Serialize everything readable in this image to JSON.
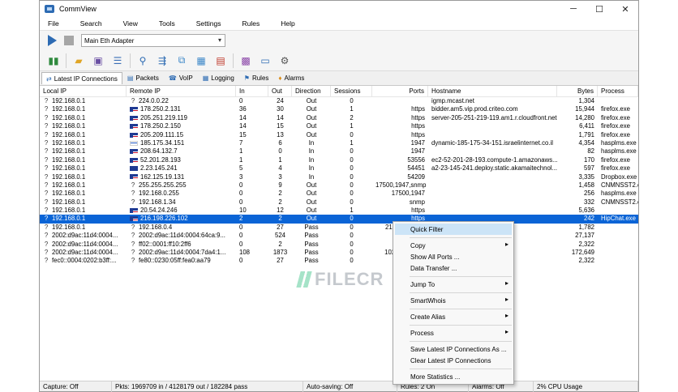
{
  "window": {
    "title": "CommView",
    "minimize": "─",
    "maximize": "☐",
    "close": "✕"
  },
  "menu": [
    "File",
    "Search",
    "View",
    "Tools",
    "Settings",
    "Rules",
    "Help"
  ],
  "adapter": {
    "value": "Main Eth Adapter"
  },
  "tabs": [
    {
      "label": "Latest IP Connections",
      "icon": "connections-icon"
    },
    {
      "label": "Packets",
      "icon": "packets-icon"
    },
    {
      "label": "VoIP",
      "icon": "voip-icon"
    },
    {
      "label": "Logging",
      "icon": "logging-icon"
    },
    {
      "label": "Rules",
      "icon": "rules-icon"
    },
    {
      "label": "Alarms",
      "icon": "alarms-icon"
    }
  ],
  "columns": [
    "Local IP",
    "Remote IP",
    "In",
    "Out",
    "Direction",
    "Sessions",
    "Ports",
    "Hostname",
    "Bytes",
    "Process"
  ],
  "rows": [
    {
      "local": "192.168.0.1",
      "flag": "none",
      "remote": "224.0.0.22",
      "in": "0",
      "out": "24",
      "dir": "Out",
      "sess": "0",
      "ports": "",
      "host": "igmp.mcast.net",
      "bytes": "1,304",
      "proc": ""
    },
    {
      "local": "192.168.0.1",
      "flag": "us",
      "remote": "178.250.2.131",
      "in": "36",
      "out": "30",
      "dir": "Out",
      "sess": "1",
      "ports": "https",
      "host": "bidder.am5.vip.prod.criteo.com",
      "bytes": "15,944",
      "proc": "firefox.exe"
    },
    {
      "local": "192.168.0.1",
      "flag": "us",
      "remote": "205.251.219.119",
      "in": "14",
      "out": "14",
      "dir": "Out",
      "sess": "2",
      "ports": "https",
      "host": "server-205-251-219-119.am1.r.cloudfront.net",
      "bytes": "14,280",
      "proc": "firefox.exe"
    },
    {
      "local": "192.168.0.1",
      "flag": "us",
      "remote": "178.250.2.150",
      "in": "14",
      "out": "15",
      "dir": "Out",
      "sess": "1",
      "ports": "https",
      "host": "",
      "bytes": "6,411",
      "proc": "firefox.exe"
    },
    {
      "local": "192.168.0.1",
      "flag": "us",
      "remote": "205.209.111.15",
      "in": "15",
      "out": "13",
      "dir": "Out",
      "sess": "0",
      "ports": "https",
      "host": "",
      "bytes": "1,791",
      "proc": "firefox.exe"
    },
    {
      "local": "192.168.0.1",
      "flag": "il",
      "remote": "185.175.34.151",
      "in": "7",
      "out": "6",
      "dir": "In",
      "sess": "1",
      "ports": "1947",
      "host": "dynamic-185-175-34-151.israelinternet.co.il",
      "bytes": "4,354",
      "proc": "hasplms.exe"
    },
    {
      "local": "192.168.0.1",
      "flag": "us",
      "remote": "208.64.132.7",
      "in": "1",
      "out": "0",
      "dir": "In",
      "sess": "0",
      "ports": "1947",
      "host": "",
      "bytes": "82",
      "proc": "hasplms.exe"
    },
    {
      "local": "192.168.0.1",
      "flag": "us",
      "remote": "52.201.28.193",
      "in": "1",
      "out": "1",
      "dir": "In",
      "sess": "0",
      "ports": "53556",
      "host": "ec2-52-201-28-193.compute-1.amazonaws...",
      "bytes": "170",
      "proc": "firefox.exe"
    },
    {
      "local": "192.168.0.1",
      "flag": "eu",
      "remote": "2.23.145.241",
      "in": "5",
      "out": "4",
      "dir": "In",
      "sess": "0",
      "ports": "54451",
      "host": "a2-23-145-241.deploy.static.akamaitechnol...",
      "bytes": "597",
      "proc": "firefox.exe"
    },
    {
      "local": "192.168.0.1",
      "flag": "us",
      "remote": "162.125.19.131",
      "in": "3",
      "out": "3",
      "dir": "In",
      "sess": "0",
      "ports": "54209",
      "host": "",
      "bytes": "3,335",
      "proc": "Dropbox.exe"
    },
    {
      "local": "192.168.0.1",
      "flag": "none",
      "remote": "255.255.255.255",
      "in": "0",
      "out": "9",
      "dir": "Out",
      "sess": "0",
      "ports": "17500,1947,snmp",
      "host": "",
      "bytes": "1,458",
      "proc": "CNMNSST2.exe"
    },
    {
      "local": "192.168.0.1",
      "flag": "none",
      "remote": "192.168.0.255",
      "in": "0",
      "out": "2",
      "dir": "Out",
      "sess": "0",
      "ports": "17500,1947",
      "host": "",
      "bytes": "256",
      "proc": "hasplms.exe"
    },
    {
      "local": "192.168.0.1",
      "flag": "none",
      "remote": "192.168.1.34",
      "in": "0",
      "out": "2",
      "dir": "Out",
      "sess": "0",
      "ports": "snmp",
      "host": "",
      "bytes": "332",
      "proc": "CNMNSST2.exe"
    },
    {
      "local": "192.168.0.1",
      "flag": "us",
      "remote": "20.54.24.246",
      "in": "10",
      "out": "12",
      "dir": "Out",
      "sess": "1",
      "ports": "https",
      "host": "",
      "bytes": "5,636",
      "proc": ""
    },
    {
      "local": "192.168.0.1",
      "flag": "us",
      "remote": "216.198.226.102",
      "in": "2",
      "out": "2",
      "dir": "Out",
      "sess": "0",
      "ports": "https",
      "host": "",
      "bytes": "242",
      "proc": "HipChat.exe",
      "selected": true
    },
    {
      "local": "192.168.0.1",
      "flag": "none",
      "remote": "192.168.0.4",
      "in": "0",
      "out": "27",
      "dir": "Pass",
      "sess": "0",
      "ports": "2140,micros...",
      "host": "",
      "bytes": "1,782",
      "proc": ""
    },
    {
      "local": "2002:d9ac:11d4:0004...",
      "flag": "none",
      "remote": "2002:d9ac:11d4:0004:64ca:9...",
      "in": "0",
      "out": "524",
      "dir": "Pass",
      "sess": "0",
      "ports": "7078,51...",
      "host": "",
      "bytes": "27,137",
      "proc": ""
    },
    {
      "local": "2002:d9ac:11d4:0004...",
      "flag": "none",
      "remote": "ff02::0001:ff10:2ff6",
      "in": "0",
      "out": "2",
      "dir": "Pass",
      "sess": "0",
      "ports": "",
      "host": "",
      "bytes": "2,322",
      "proc": ""
    },
    {
      "local": "2002:d9ac:11d4:0004...",
      "flag": "none",
      "remote": "2002:d9ac:11d4:0004:7da4:1...",
      "in": "108",
      "out": "1873",
      "dir": "Pass",
      "sess": "0",
      "ports": "1028,5060,5...",
      "host": "",
      "bytes": "172,649",
      "proc": ""
    },
    {
      "local": "fec0::0004:0202:b3ff:...",
      "flag": "none",
      "remote": "fe80::0230:05ff:fea0:aa79",
      "in": "0",
      "out": "27",
      "dir": "Pass",
      "sess": "0",
      "ports": "",
      "host": "",
      "bytes": "2,322",
      "proc": ""
    }
  ],
  "context_menu": [
    {
      "label": "Quick Filter",
      "arrow": false,
      "hover": true
    },
    {
      "sep": true
    },
    {
      "label": "Copy",
      "arrow": true
    },
    {
      "label": "Show All Ports ...",
      "arrow": false
    },
    {
      "label": "Data Transfer ...",
      "arrow": false
    },
    {
      "sep": true
    },
    {
      "label": "Jump To",
      "arrow": true
    },
    {
      "sep": true
    },
    {
      "label": "SmartWhois",
      "arrow": true
    },
    {
      "sep": true
    },
    {
      "label": "Create Alias",
      "arrow": true
    },
    {
      "sep": true
    },
    {
      "label": "Process",
      "arrow": true
    },
    {
      "sep": true
    },
    {
      "label": "Save Latest IP Connections As ...",
      "arrow": false
    },
    {
      "label": "Clear Latest IP Connections",
      "arrow": false
    },
    {
      "sep": true
    },
    {
      "label": "More Statistics ...",
      "arrow": false
    }
  ],
  "watermark": "FILECR",
  "status": [
    {
      "text": "Capture: Off",
      "w": 89
    },
    {
      "text": "Pkts: 1969709 in / 4128179 out / 182284 pass",
      "w": 236
    },
    {
      "text": "Auto-saving: Off",
      "w": 116
    },
    {
      "text": "Rules: 2 On",
      "w": 88
    },
    {
      "text": "Alarms: Off",
      "w": 80
    },
    {
      "text": "2% CPU Usage",
      "w": 129
    }
  ]
}
